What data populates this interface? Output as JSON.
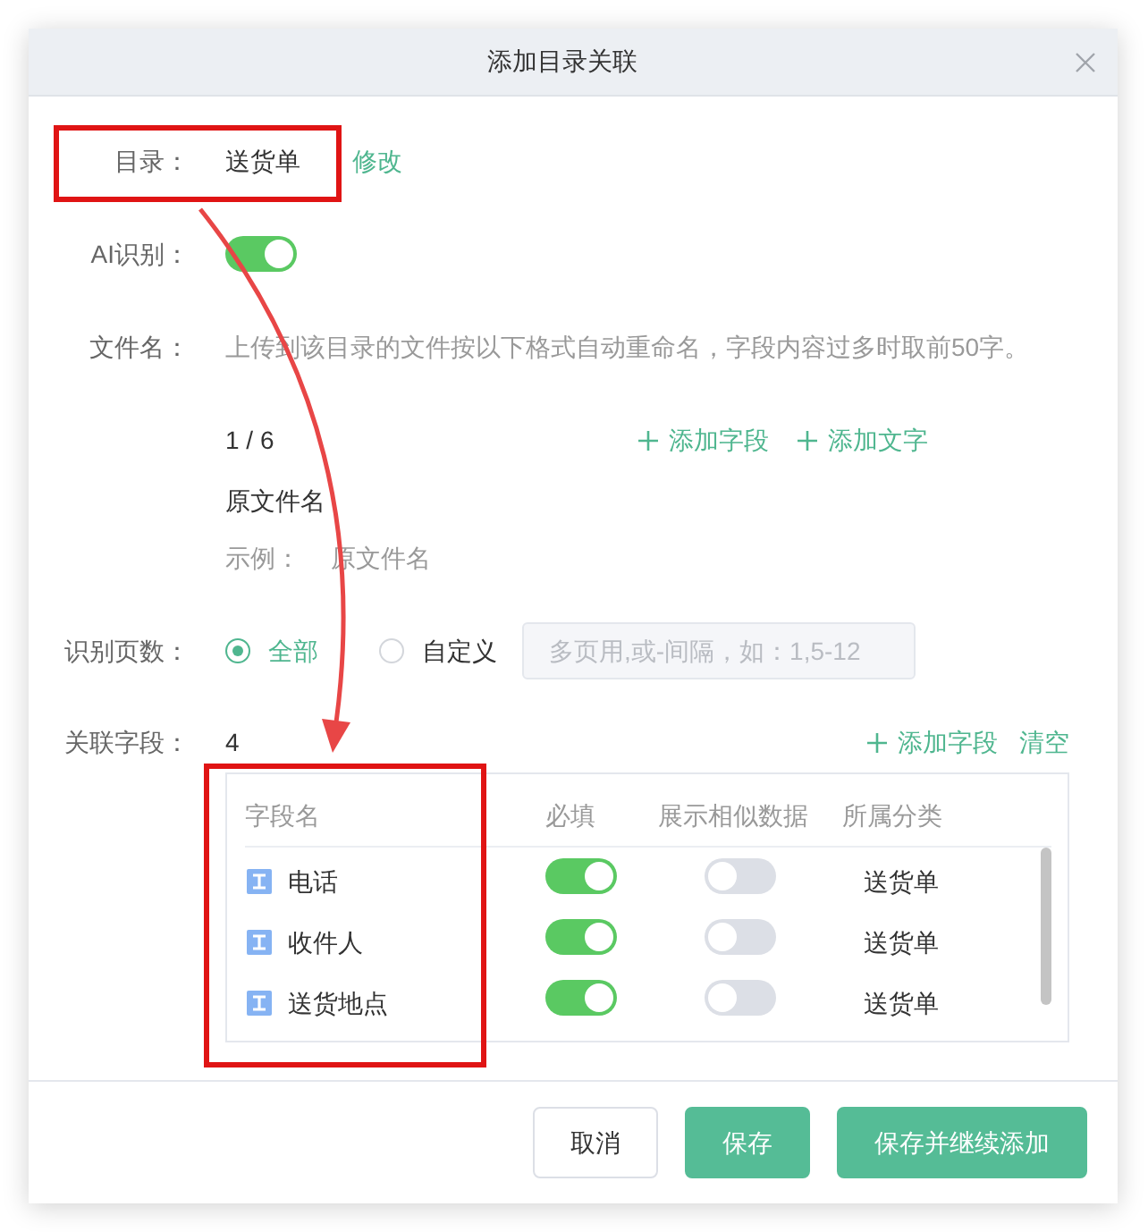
{
  "dialog": {
    "title": "添加目录关联"
  },
  "directory": {
    "label": "目录：",
    "value": "送货单",
    "link": "修改"
  },
  "ai_recognition": {
    "label": "AI识别：",
    "on": true
  },
  "file_name": {
    "label": "文件名：",
    "description": "上传到该目录的文件按以下格式自动重命名，字段内容过多时取前50字。",
    "counter": "1 / 6",
    "actions": [
      {
        "kind": "add",
        "label": "添加字段"
      },
      {
        "kind": "add",
        "label": "添加文字"
      }
    ],
    "value": "原文件名",
    "example_label": "示例：",
    "example_value": "原文件名"
  },
  "pages": {
    "label": "识别页数：",
    "options": [
      {
        "label": "全部",
        "selected": true
      },
      {
        "label": "自定义",
        "selected": false
      }
    ],
    "input": {
      "placeholder": "多页用,或-间隔，如：1,5-12"
    }
  },
  "linked_fields": {
    "label": "关联字段：",
    "count": "4",
    "actions": [
      {
        "kind": "add",
        "label": "添加字段"
      },
      {
        "kind": "clear",
        "label": "清空"
      }
    ],
    "table": {
      "columns": [
        "字段名",
        "必填",
        "展示相似数据",
        "所属分类"
      ],
      "rows": [
        {
          "name": "电话",
          "required": true,
          "show_similar": false,
          "category": "送货单"
        },
        {
          "name": "收件人",
          "required": true,
          "show_similar": false,
          "category": "送货单"
        },
        {
          "name": "送货地点",
          "required": true,
          "show_similar": false,
          "category": "送货单"
        }
      ]
    }
  },
  "footer": {
    "buttons": [
      {
        "kind": "default",
        "label": "取消"
      },
      {
        "kind": "primary",
        "label": "保存"
      },
      {
        "kind": "primary",
        "label": "保存并继续添加"
      }
    ]
  },
  "annotations": [
    {
      "kind": "box"
    },
    {
      "kind": "box"
    },
    {
      "kind": "arrow"
    }
  ]
}
